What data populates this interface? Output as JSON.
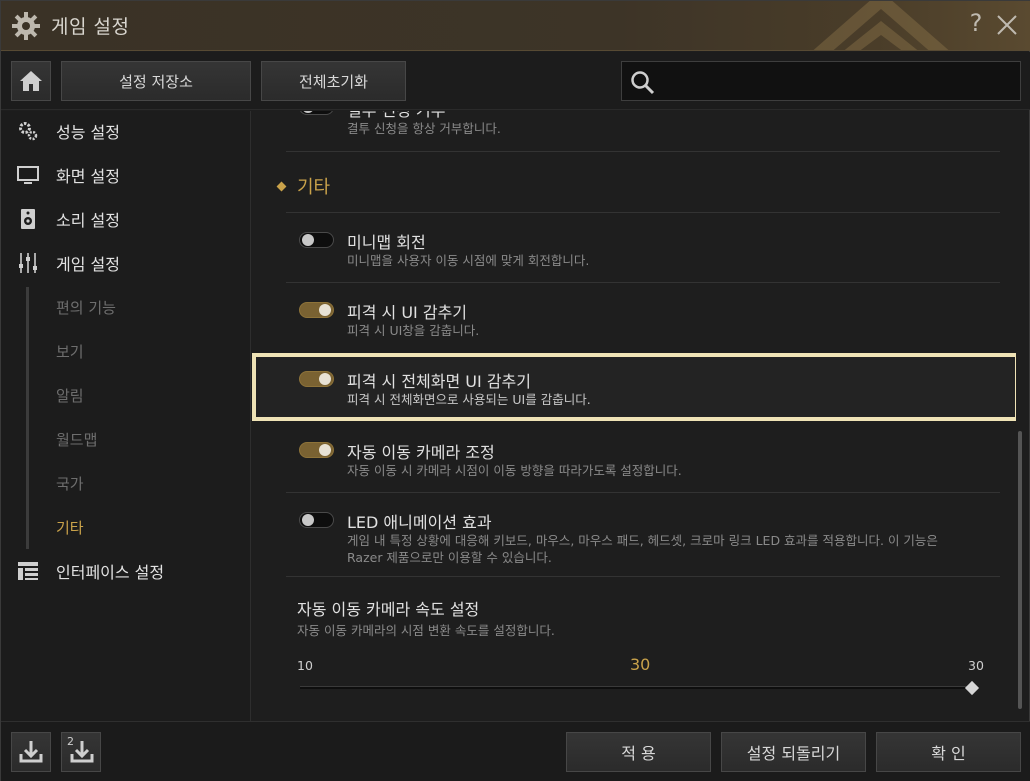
{
  "window": {
    "title": "게임 설정",
    "help_label": "?"
  },
  "toolbar": {
    "save_store_label": "설정 저장소",
    "reset_all_label": "전체초기화",
    "search_placeholder": ""
  },
  "sidebar": {
    "items": [
      {
        "label": "성능 설정",
        "icon": "gears-icon"
      },
      {
        "label": "화면 설정",
        "icon": "monitor-icon"
      },
      {
        "label": "소리 설정",
        "icon": "speaker-icon"
      },
      {
        "label": "게임 설정",
        "icon": "sliders-icon"
      },
      {
        "label": "인터페이스 설정",
        "icon": "layout-icon"
      }
    ],
    "sub_items": [
      {
        "label": "편의 기능"
      },
      {
        "label": "보기"
      },
      {
        "label": "알림"
      },
      {
        "label": "월드맵"
      },
      {
        "label": "국가"
      },
      {
        "label": "기타"
      }
    ]
  },
  "content": {
    "partial_row": {
      "title": "결투 신청 거부",
      "desc": "결투 신청을 항상 거부합니다."
    },
    "section_title": "기타",
    "options": [
      {
        "title": "미니맵 회전",
        "desc": "미니맵을 사용자 이동 시점에 맞게 회전합니다.",
        "on": false
      },
      {
        "title": "피격 시 UI 감추기",
        "desc": "피격 시 UI창을 감춥니다.",
        "on": true
      },
      {
        "title": "피격 시 전체화면 UI 감추기",
        "desc": "피격 시 전체화면으로 사용되는 UI를 감춥니다.",
        "on": true
      },
      {
        "title": "자동 이동 카메라 조정",
        "desc": "자동 이동 시 카메라 시점이 이동 방향을 따라가도록 설정합니다.",
        "on": true
      },
      {
        "title": "LED 애니메이션 효과",
        "desc": "게임 내 특정 상황에 대응해 키보드, 마우스, 마우스 패드, 헤드셋, 크로마 링크 LED 효과를 적용합니다. 이 기능은 Razer 제품으로만 이용할 수 있습니다.",
        "on": false
      }
    ],
    "slider": {
      "title": "자동 이동 카메라 속도 설정",
      "desc": "자동 이동 카메라의 시점 변환 속도를 설정합니다.",
      "min": "10",
      "max": "30",
      "value": "30"
    }
  },
  "footer": {
    "apply_label": "적 용",
    "revert_label": "설정 되돌리기",
    "confirm_label": "확 인",
    "slot2_label": "2"
  },
  "colors": {
    "accent": "#c9a24a",
    "highlight_border": "#efe3b6",
    "toggle_on": "#7a6232"
  }
}
